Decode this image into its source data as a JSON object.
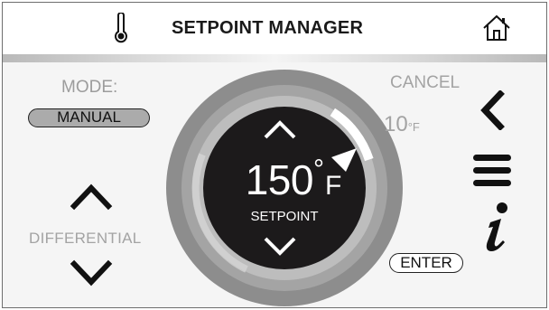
{
  "header": {
    "title": "SETPOINT MANAGER",
    "left_icon": "thermometer-icon",
    "right_icon": "home-icon"
  },
  "mode": {
    "label": "MODE:",
    "value": "MANUAL"
  },
  "cancel_label": "CANCEL",
  "setpoint": {
    "value": "150",
    "degree": "°",
    "unit": "F",
    "label": "SETPOINT",
    "differential_value": "10",
    "differential_unit": "°F"
  },
  "differential": {
    "label": "DIFFERENTIAL"
  },
  "enter_label": "ENTER",
  "side_icons": [
    "back-chevron-icon",
    "menu-icon",
    "info-icon"
  ],
  "colors": {
    "dial_center": "#1c1a1b",
    "ring_outer": "#8d8d8d",
    "ring_inner": "#b6b6b6",
    "muted_text": "#a3a3a3",
    "manual_button": "#ababab"
  }
}
